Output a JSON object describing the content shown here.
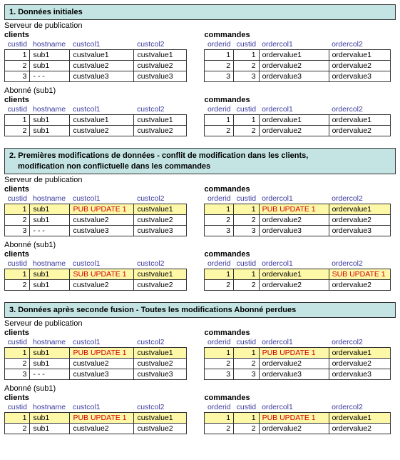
{
  "sections": [
    {
      "header": "1. Données initiales",
      "sub": "",
      "groups": [
        {
          "subtitle": "Serveur de publication",
          "clients": {
            "title": "clients",
            "headers": [
              "custid",
              "hostname",
              "custcol1",
              "custcol2"
            ],
            "rows": [
              {
                "hl": false,
                "cells": [
                  "1",
                  "sub1",
                  "custvalue1",
                  "custvalue1"
                ],
                "chg": []
              },
              {
                "hl": false,
                "cells": [
                  "2",
                  "sub1",
                  "custvalue2",
                  "custvalue2"
                ],
                "chg": []
              },
              {
                "hl": false,
                "cells": [
                  "3",
                  "- - -",
                  "custvalue3",
                  "custvalue3"
                ],
                "chg": []
              }
            ]
          },
          "commandes": {
            "title": "commandes",
            "headers": [
              "orderid",
              "custid",
              "ordercol1",
              "ordercol2"
            ],
            "rows": [
              {
                "hl": false,
                "cells": [
                  "1",
                  "1",
                  "ordervalue1",
                  "ordervalue1"
                ],
                "chg": []
              },
              {
                "hl": false,
                "cells": [
                  "2",
                  "2",
                  "ordervalue2",
                  "ordervalue2"
                ],
                "chg": []
              },
              {
                "hl": false,
                "cells": [
                  "3",
                  "3",
                  "ordervalue3",
                  "ordervalue3"
                ],
                "chg": []
              }
            ]
          }
        },
        {
          "subtitle": "Abonné (sub1)",
          "clients": {
            "title": "clients",
            "headers": [
              "custid",
              "hostname",
              "custcol1",
              "custcol2"
            ],
            "rows": [
              {
                "hl": false,
                "cells": [
                  "1",
                  "sub1",
                  "custvalue1",
                  "custvalue1"
                ],
                "chg": []
              },
              {
                "hl": false,
                "cells": [
                  "2",
                  "sub1",
                  "custvalue2",
                  "custvalue2"
                ],
                "chg": []
              }
            ]
          },
          "commandes": {
            "title": "commandes",
            "headers": [
              "orderid",
              "custid",
              "ordercol1",
              "ordercol2"
            ],
            "rows": [
              {
                "hl": false,
                "cells": [
                  "1",
                  "1",
                  "ordervalue1",
                  "ordervalue1"
                ],
                "chg": []
              },
              {
                "hl": false,
                "cells": [
                  "2",
                  "2",
                  "ordervalue2",
                  "ordervalue2"
                ],
                "chg": []
              }
            ]
          }
        }
      ]
    },
    {
      "header": "2. Premières modifications de données - conflit de modification dans les clients,",
      "sub": "modification non conflictuelle dans les commandes",
      "groups": [
        {
          "subtitle": "Serveur de publication",
          "clients": {
            "title": "clients",
            "headers": [
              "custid",
              "hostname",
              "custcol1",
              "custcol2"
            ],
            "rows": [
              {
                "hl": true,
                "cells": [
                  "1",
                  "sub1",
                  "PUB UPDATE 1",
                  "custvalue1"
                ],
                "chg": [
                  2
                ]
              },
              {
                "hl": false,
                "cells": [
                  "2",
                  "sub1",
                  "custvalue2",
                  "custvalue2"
                ],
                "chg": []
              },
              {
                "hl": false,
                "cells": [
                  "3",
                  "- - -",
                  "custvalue3",
                  "custvalue3"
                ],
                "chg": []
              }
            ]
          },
          "commandes": {
            "title": "commandes",
            "headers": [
              "orderid",
              "custid",
              "ordercol1",
              "ordercol2"
            ],
            "rows": [
              {
                "hl": true,
                "cells": [
                  "1",
                  "1",
                  "PUB UPDATE 1",
                  "ordervalue1"
                ],
                "chg": [
                  2
                ]
              },
              {
                "hl": false,
                "cells": [
                  "2",
                  "2",
                  "ordervalue2",
                  "ordervalue2"
                ],
                "chg": []
              },
              {
                "hl": false,
                "cells": [
                  "3",
                  "3",
                  "ordervalue3",
                  "ordervalue3"
                ],
                "chg": []
              }
            ]
          }
        },
        {
          "subtitle": "Abonné (sub1)",
          "clients": {
            "title": "clients",
            "headers": [
              "custid",
              "hostname",
              "custcol1",
              "custcol2"
            ],
            "rows": [
              {
                "hl": true,
                "cells": [
                  "1",
                  "sub1",
                  "SUB UPDATE 1",
                  "custvalue1"
                ],
                "chg": [
                  2
                ]
              },
              {
                "hl": false,
                "cells": [
                  "2",
                  "sub1",
                  "custvalue2",
                  "custvalue2"
                ],
                "chg": []
              }
            ]
          },
          "commandes": {
            "title": "commandes",
            "headers": [
              "orderid",
              "custid",
              "ordercol1",
              "ordercol2"
            ],
            "rows": [
              {
                "hl": true,
                "cells": [
                  "1",
                  "1",
                  "ordervalue1",
                  "SUB UPDATE 1"
                ],
                "chg": [
                  3
                ]
              },
              {
                "hl": false,
                "cells": [
                  "2",
                  "2",
                  "ordervalue2",
                  "ordervalue2"
                ],
                "chg": []
              }
            ]
          }
        }
      ]
    },
    {
      "header": "3. Données après seconde fusion - Toutes les modifications Abonné perdues",
      "sub": "",
      "groups": [
        {
          "subtitle": "Serveur de publication",
          "clients": {
            "title": "clients",
            "headers": [
              "custid",
              "hostname",
              "custcol1",
              "custcol2"
            ],
            "rows": [
              {
                "hl": true,
                "cells": [
                  "1",
                  "sub1",
                  "PUB UPDATE 1",
                  "custvalue1"
                ],
                "chg": [
                  2
                ]
              },
              {
                "hl": false,
                "cells": [
                  "2",
                  "sub1",
                  "custvalue2",
                  "custvalue2"
                ],
                "chg": []
              },
              {
                "hl": false,
                "cells": [
                  "3",
                  "- - -",
                  "custvalue3",
                  "custvalue3"
                ],
                "chg": []
              }
            ]
          },
          "commandes": {
            "title": "commandes",
            "headers": [
              "orderid",
              "custid",
              "ordercol1",
              "ordercol2"
            ],
            "rows": [
              {
                "hl": true,
                "cells": [
                  "1",
                  "1",
                  "PUB UPDATE 1",
                  "ordervalue1"
                ],
                "chg": [
                  2
                ]
              },
              {
                "hl": false,
                "cells": [
                  "2",
                  "2",
                  "ordervalue2",
                  "ordervalue2"
                ],
                "chg": []
              },
              {
                "hl": false,
                "cells": [
                  "3",
                  "3",
                  "ordervalue3",
                  "ordervalue3"
                ],
                "chg": []
              }
            ]
          }
        },
        {
          "subtitle": "Abonné (sub1)",
          "clients": {
            "title": "clients",
            "headers": [
              "custid",
              "hostname",
              "custcol1",
              "custcol2"
            ],
            "rows": [
              {
                "hl": true,
                "cells": [
                  "1",
                  "sub1",
                  "PUB UPDATE 1",
                  "custvalue1"
                ],
                "chg": [
                  2
                ]
              },
              {
                "hl": false,
                "cells": [
                  "2",
                  "sub1",
                  "custvalue2",
                  "custvalue2"
                ],
                "chg": []
              }
            ]
          },
          "commandes": {
            "title": "commandes",
            "headers": [
              "orderid",
              "custid",
              "ordercol1",
              "ordercol2"
            ],
            "rows": [
              {
                "hl": true,
                "cells": [
                  "1",
                  "1",
                  "PUB UPDATE 1",
                  "ordervalue1"
                ],
                "chg": [
                  2
                ]
              },
              {
                "hl": false,
                "cells": [
                  "2",
                  "2",
                  "ordervalue2",
                  "ordervalue2"
                ],
                "chg": []
              }
            ]
          }
        }
      ]
    }
  ]
}
